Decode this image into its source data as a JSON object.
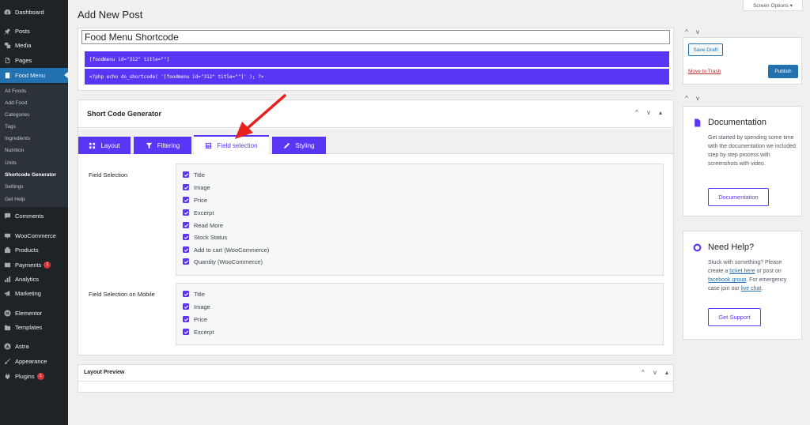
{
  "sidebar": {
    "items": [
      {
        "label": "Dashboard",
        "icon": "dashboard-icon"
      },
      {
        "label": "Posts",
        "icon": "pin-icon"
      },
      {
        "label": "Media",
        "icon": "media-icon"
      },
      {
        "label": "Pages",
        "icon": "page-icon"
      },
      {
        "label": "Food Menu",
        "icon": "food-menu-icon"
      },
      {
        "label": "Comments",
        "icon": "comment-icon"
      },
      {
        "label": "WooCommerce",
        "icon": "woocommerce-icon"
      },
      {
        "label": "Products",
        "icon": "product-icon"
      },
      {
        "label": "Payments",
        "icon": "payments-icon",
        "badge": "1"
      },
      {
        "label": "Analytics",
        "icon": "analytics-icon"
      },
      {
        "label": "Marketing",
        "icon": "megaphone-icon"
      },
      {
        "label": "Elementor",
        "icon": "elementor-icon"
      },
      {
        "label": "Templates",
        "icon": "folder-icon"
      },
      {
        "label": "Astra",
        "icon": "astra-icon"
      },
      {
        "label": "Appearance",
        "icon": "brush-icon"
      },
      {
        "label": "Plugins",
        "icon": "plug-icon",
        "badge": "1"
      }
    ],
    "submenu": [
      "All Foods",
      "Add Food",
      "Categories",
      "Tags",
      "Ingredients",
      "Nutrition",
      "Units",
      "Shortcode Generator",
      "Settings",
      "Get Help"
    ]
  },
  "header": {
    "title": "Add New Post",
    "screen_options": "Screen Options ▾"
  },
  "post": {
    "title": "Food Menu Shortcode",
    "shortcode": "[foodmenu id=\"312\" title=\"\"]",
    "php_code": "<?php echo do_shortcode( '[foodmenu id=\"312\" title=\"\"]' ); ?>"
  },
  "generator": {
    "title": "Short Code Generator",
    "controls": [
      "^",
      "v",
      "▴"
    ],
    "tabs": [
      {
        "label": "Layout",
        "icon": "grid-icon"
      },
      {
        "label": "Filtering",
        "icon": "filter-icon"
      },
      {
        "label": "Field selection",
        "icon": "table-icon"
      },
      {
        "label": "Styling",
        "icon": "pen-icon"
      }
    ],
    "field_selection": {
      "label": "Field Selection",
      "options": [
        "Title",
        "Image",
        "Price",
        "Excerpt",
        "Read More",
        "Stock Status",
        "Add to cart (WooCommerce)",
        "Quantity (WooCommerce)"
      ]
    },
    "field_selection_mobile": {
      "label": "Field Selection on Mobile",
      "options": [
        "Title",
        "Image",
        "Price",
        "Excerpt"
      ]
    }
  },
  "preview": {
    "title": "Layout Preview",
    "controls": [
      "^",
      "v",
      "▴"
    ]
  },
  "publish": {
    "save_draft": "Save Draft",
    "trash": "Move to Trash",
    "publish": "Publish"
  },
  "documentation": {
    "heading": "Documentation",
    "text": "Get started by spending some time with the documentation we included step by step process with screenshots with video.",
    "button": "Documentation"
  },
  "help": {
    "heading": "Need Help?",
    "text_1": "Stuck with something? Please create a ",
    "link_1": "ticket here",
    "text_2": " or post on ",
    "link_2": "facebook group",
    "text_3": ". For emergency case join our ",
    "link_3": "live chat",
    "text_4": ".",
    "button": "Get Support"
  },
  "colors": {
    "accent": "#5b35f5",
    "wp_blue": "#2271b1",
    "sidebar_bg": "#1d2327",
    "badge": "#d63638",
    "arrow": "#e8211d"
  }
}
